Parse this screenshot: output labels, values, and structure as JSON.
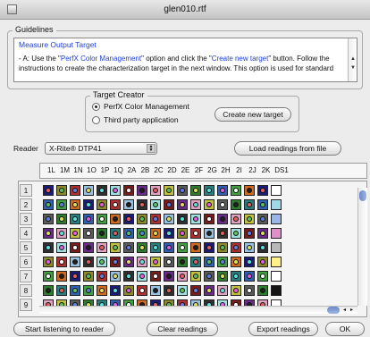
{
  "window": {
    "title": "glen010.rtf"
  },
  "guidelines": {
    "title": "Guidelines",
    "heading": "Measure Output Target",
    "line1_prefix": "- A: Use the \"",
    "line1_link1": "PerfX Color Management",
    "line1_mid": "\" option and click  the \"",
    "line1_link2": "Create new target",
    "line1_suffix": "\" button. Follow the",
    "line2": "instructions to create the characterization target in the next window. This option is used for standard"
  },
  "target_creator": {
    "title": "Target Creator",
    "option1": "PerfX Color Management",
    "option2": "Third party application",
    "selected": "PerfX Color Management",
    "create_button": "Create new target"
  },
  "reader": {
    "label": "Reader",
    "selected": "X-Rite® DTP41",
    "load_button": "Load readings from file"
  },
  "grid": {
    "columns": [
      "1L",
      "1M",
      "1N",
      "1O",
      "1P",
      "1Q",
      "2A",
      "2B",
      "2C",
      "2D",
      "2E",
      "2F",
      "2G",
      "2H",
      "2I",
      "2J",
      "2K",
      "DS1"
    ],
    "rows": [
      "1",
      "2",
      "3",
      "4",
      "5",
      "6",
      "7",
      "8",
      "9"
    ]
  },
  "buttons": {
    "listen": "Start listening to reader",
    "clear": "Clear readings",
    "export": "Export readings",
    "ok": "OK"
  },
  "colors": {
    "link_blue": "#1f3fd6",
    "scroll_blue": "#6a88c8"
  },
  "icons": {
    "close": "close-box-icon",
    "scroll_up": "scroll-up-arrow-icon",
    "scroll_down": "scroll-down-arrow-icon",
    "select_arrows": "select-arrows-icon"
  }
}
